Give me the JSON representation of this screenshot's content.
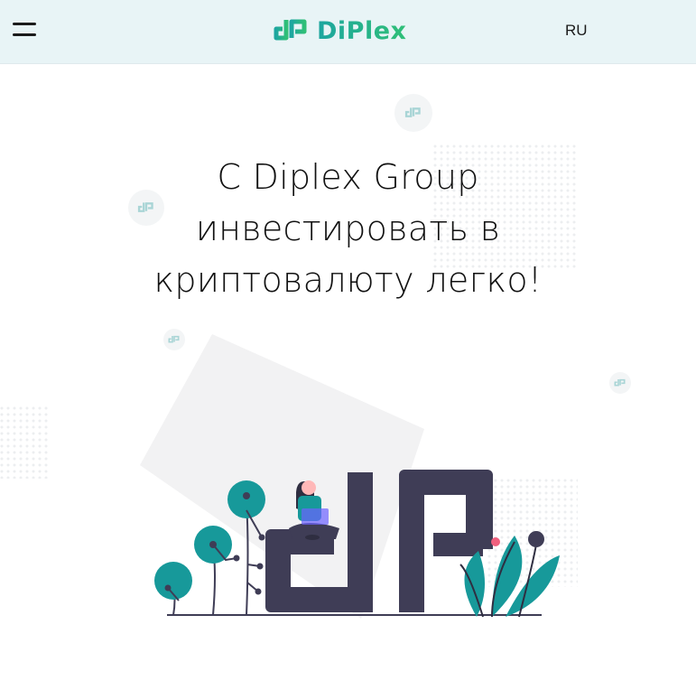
{
  "header": {
    "menu_icon": "hamburger-menu-icon",
    "logo_icon": "diplex-logo-mark-icon",
    "brand_name": "DiPlex",
    "language": "RU"
  },
  "hero": {
    "headline_line1": "С Diplex Group",
    "headline_line2": "инвестировать в",
    "headline_line3": "криптовалюту легко!"
  },
  "colors": {
    "header_bg": "#e8f4f6",
    "brand_teal": "#1da6a0",
    "brand_green": "#2fbf77",
    "illustration_dark": "#3f3d56",
    "illustration_teal": "#17999a",
    "accent_pink": "#f0607e"
  }
}
